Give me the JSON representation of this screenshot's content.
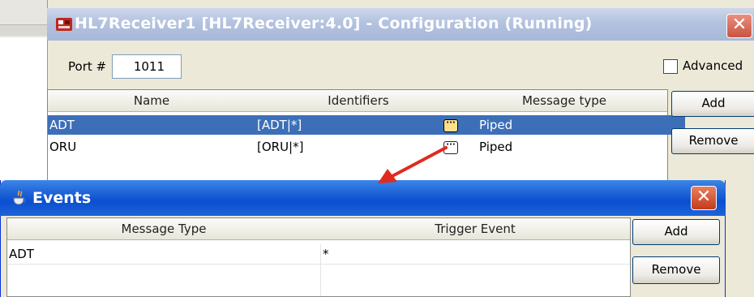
{
  "config_window": {
    "title": "HL7Receiver1 [HL7Receiver:4.0] - Configuration (Running)",
    "close_glyph": "✕",
    "port_label": "Port #",
    "port_value": "1011",
    "advanced_label": "Advanced",
    "advanced_checked": false,
    "table": {
      "columns": [
        "Name",
        "Identifiers",
        "Message type"
      ],
      "rows": [
        {
          "name": "ADT",
          "identifiers": "[ADT|*]",
          "message_type": "Piped",
          "selected": true
        },
        {
          "name": "ORU",
          "identifiers": "[ORU|*]",
          "message_type": "Piped",
          "selected": false
        }
      ]
    },
    "add_label": "Add",
    "remove_label": "Remove"
  },
  "events_window": {
    "title": "Events",
    "close_glyph": "✕",
    "table": {
      "columns": [
        "Message Type",
        "Trigger Event"
      ],
      "rows": [
        {
          "message_type": "ADT",
          "trigger_event": "*"
        }
      ]
    },
    "add_label": "Add",
    "remove_label": "Remove"
  },
  "colors": {
    "selection": "#3d6fb8",
    "events_titlebar": "#1b5fd4",
    "arrow": "#e02b1e"
  },
  "icons": [
    "app-icon",
    "java-icon",
    "ellipsis-icon",
    "close-icon"
  ]
}
